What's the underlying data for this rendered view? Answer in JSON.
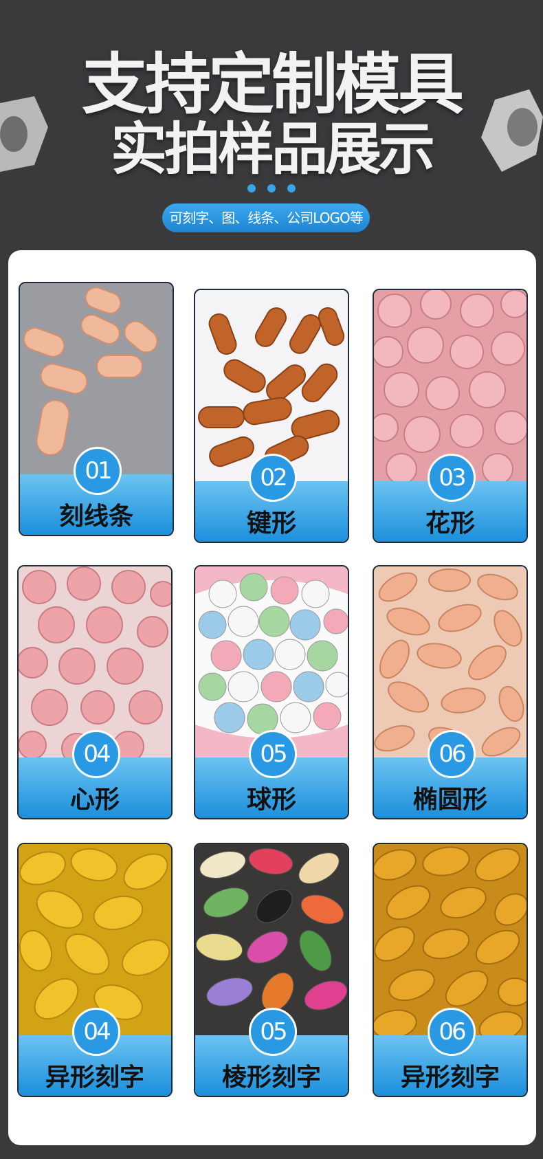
{
  "header": {
    "title_line1": "支持定制模具",
    "title_line2": "实拍样品展示",
    "subtitle_pill": "可刻字、图、线条、公司LOGO等"
  },
  "cards": [
    {
      "number": "01",
      "label": "刻线条",
      "photo_icon": "oblong-scored-tablets"
    },
    {
      "number": "02",
      "label": "键形",
      "photo_icon": "capsule-tablets"
    },
    {
      "number": "03",
      "label": "花形",
      "photo_icon": "flower-tablets"
    },
    {
      "number": "04",
      "label": "心形",
      "photo_icon": "heart-tablets"
    },
    {
      "number": "05",
      "label": "球形",
      "photo_icon": "round-candy-tablets"
    },
    {
      "number": "06",
      "label": "椭圆形",
      "photo_icon": "oval-tablets"
    },
    {
      "number": "04",
      "label": "异形刻字",
      "photo_icon": "bean-engraved-tablets"
    },
    {
      "number": "05",
      "label": "棱形刻字",
      "photo_icon": "diamond-engraved-tablets"
    },
    {
      "number": "06",
      "label": "异形刻字",
      "photo_icon": "shield-engraved-tablets"
    }
  ],
  "colors": {
    "background": "#3a393c",
    "accent_blue": "#2a99e3",
    "panel": "#ffffff"
  }
}
